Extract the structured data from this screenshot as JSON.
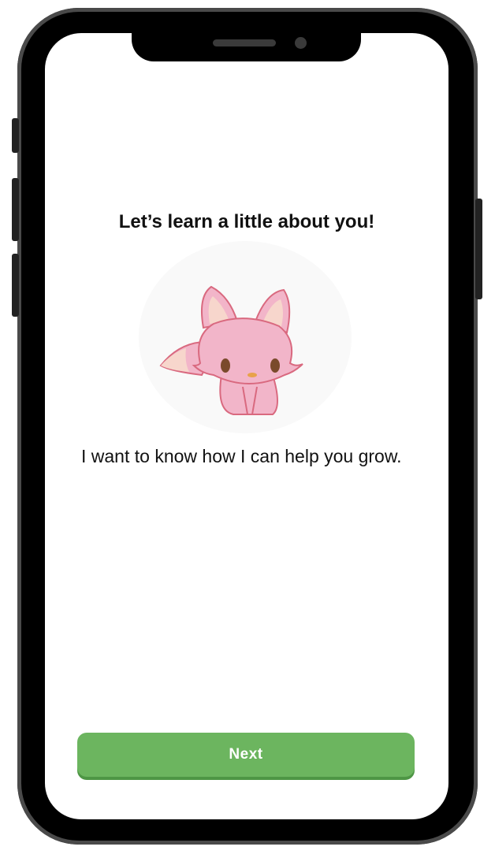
{
  "onboarding": {
    "title": "Let’s learn a little about you!",
    "subtitle": "I want to know how I can help you grow.",
    "mascot_icon": "fox-mascot",
    "next_label": "Next"
  },
  "colors": {
    "primary_button": "#6cb55f",
    "mascot_pink": "#f2b5c9"
  }
}
